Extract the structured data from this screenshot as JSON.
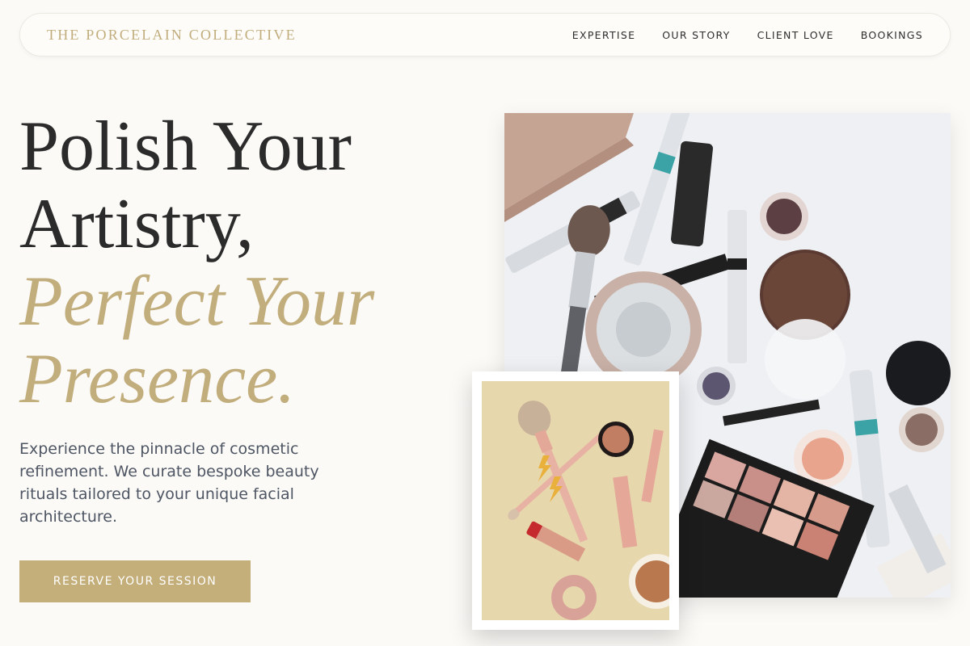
{
  "header": {
    "brand": "THE PORCELAIN COLLECTIVE",
    "nav": [
      {
        "label": "EXPERTISE"
      },
      {
        "label": "OUR STORY"
      },
      {
        "label": "CLIENT LOVE"
      },
      {
        "label": "BOOKINGS"
      }
    ]
  },
  "hero": {
    "headline_line1": "Polish Your",
    "headline_line2": "Artistry,",
    "headline_accent1": "Perfect Your",
    "headline_accent2": "Presence.",
    "description": "Experience the pinnacle of cosmetic refinement. We curate bespoke beauty rituals tailored to your unique facial architecture.",
    "cta_label": "RESERVE YOUR SESSION"
  },
  "colors": {
    "accent": "#c2ad7c",
    "text_dark": "#2b2b2b",
    "text_body": "#4e5563",
    "background": "#fbfaf7"
  }
}
